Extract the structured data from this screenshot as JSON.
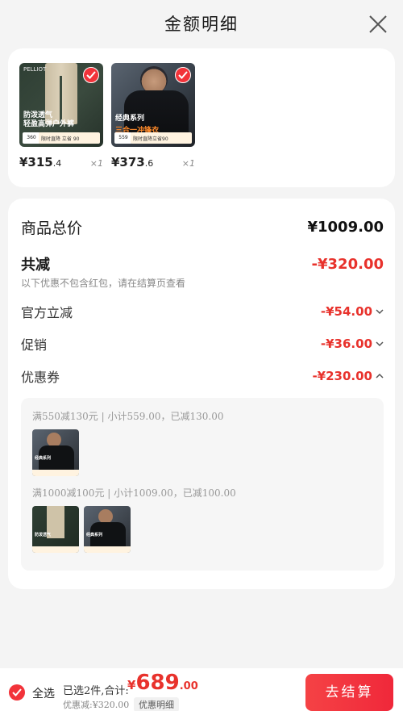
{
  "header": {
    "title": "金额明细",
    "close_icon": "close-icon"
  },
  "products": [
    {
      "name": "防泼透气 轻盈高弹户外裤",
      "price_main": "¥315",
      "price_dec": ".4",
      "qty": "×1",
      "tag_price": "360",
      "banner": "限时直降 立省 90",
      "brand": "PELLIOT",
      "selected": true
    },
    {
      "name": "经典系列 三合一冲锋衣",
      "price_main": "¥373",
      "price_dec": ".6",
      "qty": "×1",
      "tag_price": "559",
      "banner": "限时直降立省90",
      "brand": "PELLIOT",
      "selected": true
    }
  ],
  "summary": {
    "total_label": "商品总价",
    "total_value": "¥1009.00",
    "reduce_label": "共减",
    "reduce_value": "-¥320.00",
    "note": "以下优惠不包含红包，请在结算页查看",
    "items": [
      {
        "label": "官方立减",
        "value": "-¥54.00",
        "chevron": "chevron-down-icon"
      },
      {
        "label": "促销",
        "value": "-¥36.00",
        "chevron": "chevron-down-icon"
      },
      {
        "label": "优惠券",
        "value": "-¥230.00",
        "chevron": "chevron-up-icon"
      }
    ]
  },
  "coupon": {
    "group1": "满550减130元 | 小计559.00，已减130.00",
    "group2": "满1000减100元 | 小计1009.00，已减100.00",
    "mini_text1": "经典系列",
    "mini_text2": "防泼透气"
  },
  "bottom": {
    "select_all": "全选",
    "selected_info": "已选2件,合计:",
    "sum_y": "¥",
    "sum_int": "689",
    "sum_dec": ".00",
    "discount": "优惠减:¥320.00",
    "detail_button": "优惠明细",
    "pay_button": "去结算"
  },
  "colors": {
    "accent": "#e8322c",
    "button": "#f2333a"
  }
}
